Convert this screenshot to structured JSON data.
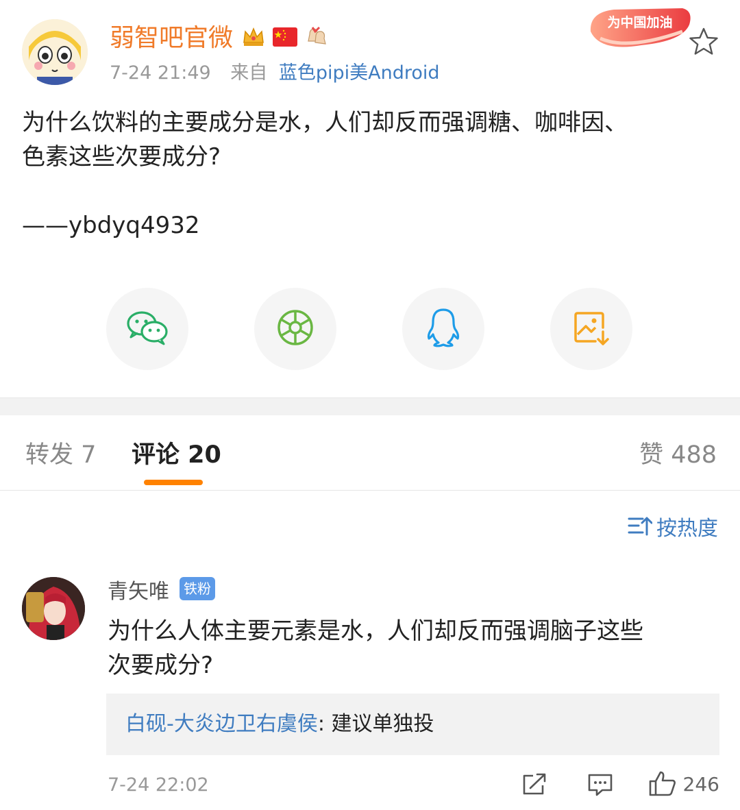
{
  "post": {
    "author": "弱智吧官微",
    "time": "7-24 21:49",
    "from_label": "来自",
    "source": "蓝色pipi美Android",
    "promo_label": "为中国加油",
    "body": "为什么饮料的主要成分是水，人们却反而强调糖、咖啡因、\n色素这些次要成分?",
    "signature": "——ybdyq4932"
  },
  "share": [
    {
      "name": "wechat-icon",
      "color": "#2aae67"
    },
    {
      "name": "moments-icon",
      "color": "#6ab743"
    },
    {
      "name": "qq-icon",
      "color": "#1e9ce8"
    },
    {
      "name": "save-image-icon",
      "color": "#f5a623"
    }
  ],
  "tabs": {
    "repost": "转发 7",
    "comment": "评论 20",
    "like": "赞 488"
  },
  "sort": {
    "label": "按热度"
  },
  "comment": {
    "author": "青矢唯",
    "fan_badge": "铁粉",
    "text": "为什么人体主要元素是水，人们却反而强调脑子这些\n次要成分?",
    "reply_author": "白砚-大炎边卫右虞侯",
    "reply_sep": ": ",
    "reply_text": "建议单独投",
    "time": "7-24 22:02",
    "likes": "246"
  },
  "colors": {
    "accent": "#ff8200",
    "link": "#3f7cc0",
    "author": "#f07b2a"
  }
}
